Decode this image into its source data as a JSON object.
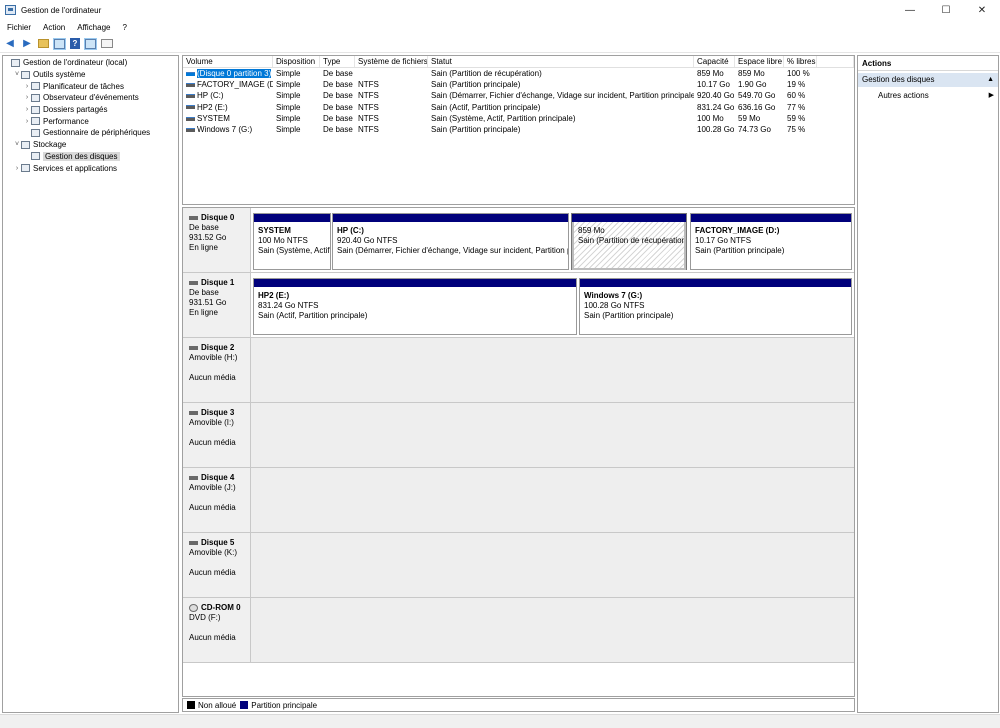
{
  "window": {
    "title": "Gestion de l'ordinateur",
    "minimize": "—",
    "maximize": "☐",
    "close": "✕"
  },
  "menu": [
    "Fichier",
    "Action",
    "Affichage",
    "?"
  ],
  "toolbar": {
    "back_icon": "back-arrow-icon",
    "forward_icon": "forward-arrow-icon"
  },
  "tree": [
    {
      "label": "Gestion de l'ordinateur (local)",
      "level": 0,
      "chev": ""
    },
    {
      "label": "Outils système",
      "level": 1,
      "chev": "˅"
    },
    {
      "label": "Planificateur de tâches",
      "level": 2,
      "chev": "›"
    },
    {
      "label": "Observateur d'événements",
      "level": 2,
      "chev": "›"
    },
    {
      "label": "Dossiers partagés",
      "level": 2,
      "chev": "›"
    },
    {
      "label": "Performance",
      "level": 2,
      "chev": "›"
    },
    {
      "label": "Gestionnaire de périphériques",
      "level": 2,
      "chev": ""
    },
    {
      "label": "Stockage",
      "level": 1,
      "chev": "˅"
    },
    {
      "label": "Gestion des disques",
      "level": 2,
      "chev": "",
      "selected": true
    },
    {
      "label": "Services et applications",
      "level": 1,
      "chev": "›"
    }
  ],
  "volumes": {
    "headers": [
      "Volume",
      "Disposition",
      "Type",
      "Système de fichiers",
      "Statut",
      "Capacité",
      "Espace libre",
      "% libres"
    ],
    "rows": [
      [
        "(Disque 0 partition 3)",
        "Simple",
        "De base",
        "",
        "Sain (Partition de récupération)",
        "859 Mo",
        "859 Mo",
        "100 %"
      ],
      [
        "FACTORY_IMAGE (D:)",
        "Simple",
        "De base",
        "NTFS",
        "Sain (Partition principale)",
        "10.17 Go",
        "1.90 Go",
        "19 %"
      ],
      [
        "HP (C:)",
        "Simple",
        "De base",
        "NTFS",
        "Sain (Démarrer, Fichier d'échange, Vidage sur incident, Partition principale)",
        "920.40 Go",
        "549.70 Go",
        "60 %"
      ],
      [
        "HP2 (E:)",
        "Simple",
        "De base",
        "NTFS",
        "Sain (Actif, Partition principale)",
        "831.24 Go",
        "636.16 Go",
        "77 %"
      ],
      [
        "SYSTEM",
        "Simple",
        "De base",
        "NTFS",
        "Sain (Système, Actif, Partition principale)",
        "100 Mo",
        "59 Mo",
        "59 %"
      ],
      [
        "Windows 7 (G:)",
        "Simple",
        "De base",
        "NTFS",
        "Sain (Partition principale)",
        "100.28 Go",
        "74.73 Go",
        "75 %"
      ]
    ]
  },
  "disks": [
    {
      "name": "Disque 0",
      "lines": [
        "De base",
        "931.52 Go",
        "En ligne"
      ],
      "partitions": [
        {
          "name": "SYSTEM",
          "size": "100 Mo NTFS",
          "status": "Sain (Système, Actif,"
        },
        {
          "name": "HP  (C:)",
          "size": "920.40 Go NTFS",
          "status": "Sain (Démarrer, Fichier d'échange, Vidage sur incident, Partition pr"
        },
        {
          "name": "",
          "size": "859 Mo",
          "status": "Sain (Partition de récupération)"
        },
        {
          "name": "FACTORY_IMAGE  (D:)",
          "size": "10.17 Go NTFS",
          "status": "Sain (Partition principale)"
        }
      ]
    },
    {
      "name": "Disque 1",
      "lines": [
        "De base",
        "931.51 Go",
        "En ligne"
      ],
      "partitions": [
        {
          "name": "HP2  (E:)",
          "size": "831.24 Go NTFS",
          "status": "Sain (Actif, Partition principale)"
        },
        {
          "name": "Windows 7  (G:)",
          "size": "100.28 Go NTFS",
          "status": "Sain (Partition principale)"
        }
      ]
    },
    {
      "name": "Disque 2",
      "lines": [
        "Amovible (H:)",
        "",
        "Aucun média"
      ]
    },
    {
      "name": "Disque 3",
      "lines": [
        "Amovible (I:)",
        "",
        "Aucun média"
      ]
    },
    {
      "name": "Disque 4",
      "lines": [
        "Amovible (J:)",
        "",
        "Aucun média"
      ]
    },
    {
      "name": "Disque 5",
      "lines": [
        "Amovible (K:)",
        "",
        "Aucun média"
      ]
    },
    {
      "name": "CD-ROM 0",
      "lines": [
        "DVD (F:)",
        "",
        "Aucun média"
      ]
    }
  ],
  "legend": {
    "unallocated": "Non alloué",
    "primary": "Partition principale",
    "unallocated_color": "#000000",
    "primary_color": "#00007b"
  },
  "actions": {
    "header": "Actions",
    "section": "Gestion des disques",
    "item": "Autres actions"
  }
}
